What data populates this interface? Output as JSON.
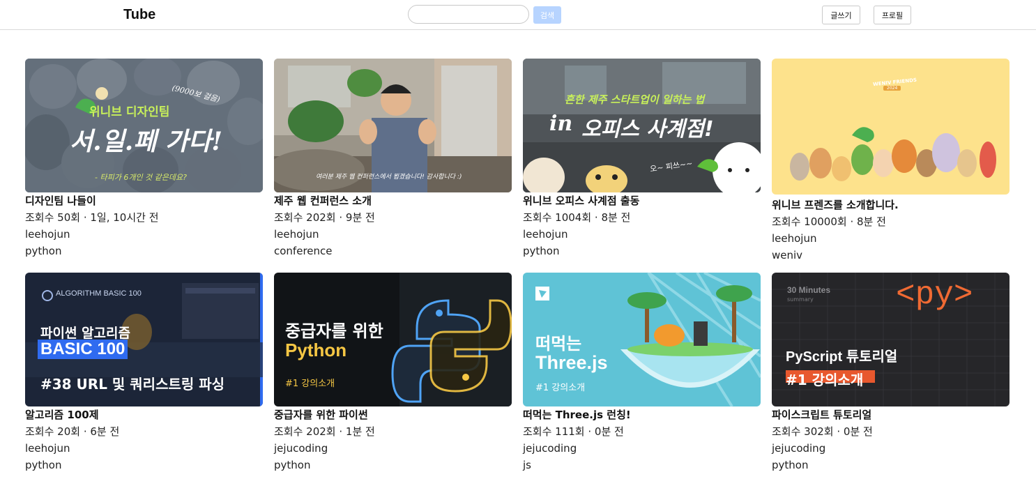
{
  "header": {
    "logo": "Tube",
    "search_placeholder": "",
    "search_button": "검색",
    "write_button": "글쓰기",
    "profile_button": "프로필"
  },
  "videos": [
    {
      "title": "디자인팀 나들이",
      "views": "조회수 50회 · 1일, 10시간 전",
      "author": "leehojun",
      "tag": "python",
      "thumb": {
        "line1": "위니브 디자인팀",
        "line2": "서.일.페 가다!",
        "note": "(9000보 걸음)",
        "caption": "- 타피가 6개인 것 같은데요?"
      }
    },
    {
      "title": "제주 웹 컨퍼런스 소개",
      "views": "조회수 202회 · 9분 전",
      "author": "leehojun",
      "tag": "conference",
      "thumb": {
        "caption": "여러분 제주 웹 컨퍼런스에서 뵙겠습니다! 감사합니다 :)"
      }
    },
    {
      "title": "위니브 오피스 사계점 출동",
      "views": "조회수 1004회 · 8분 전",
      "author": "leehojun",
      "tag": "python",
      "thumb": {
        "line1": "흔한 제주 스타트업이 일하는 법",
        "line2a": "in",
        "line2b": "오피스 사계점!",
        "caption": "오~ 피쓰~~"
      }
    },
    {
      "title": "위니브 프렌즈를 소개합니다.",
      "views": "조회수 10000회 · 8분 전",
      "author": "leehojun",
      "tag": "weniv",
      "thumb": {
        "line1": "WENIV FRIENDS",
        "badge": "2024"
      }
    },
    {
      "title": "알고리즘 100제",
      "views": "조회수 20회 · 6분 전",
      "author": "leehojun",
      "tag": "python",
      "thumb": {
        "brand": "ALGORITHM BASIC 100",
        "line1": "파이썬 알고리즘",
        "line2": "BASIC 100",
        "line3": "#38 URL 및 쿼리스트링 파싱"
      }
    },
    {
      "title": "중급자를 위한 파이썬",
      "views": "조회수 202회 · 1분 전",
      "author": "jejucoding",
      "tag": "python",
      "thumb": {
        "line1": "중급자를 위한",
        "line2": "Python",
        "line3": "#1 강의소개"
      }
    },
    {
      "title": "떠먹는 Three.js 런칭!",
      "views": "조회수 111회 · 0분 전",
      "author": "jejucoding",
      "tag": "js",
      "thumb": {
        "line1": "떠먹는",
        "line2": "Three.js",
        "line3": "#1 강의소개"
      }
    },
    {
      "title": "파이스크립트 튜토리얼",
      "views": "조회수 302회 · 0분 전",
      "author": "jejucoding",
      "tag": "python",
      "thumb": {
        "small1": "30 Minutes",
        "small2": "summary",
        "line1": "<py>",
        "line2": "PyScript 튜토리얼",
        "line3": "#1 강의소개"
      }
    }
  ]
}
